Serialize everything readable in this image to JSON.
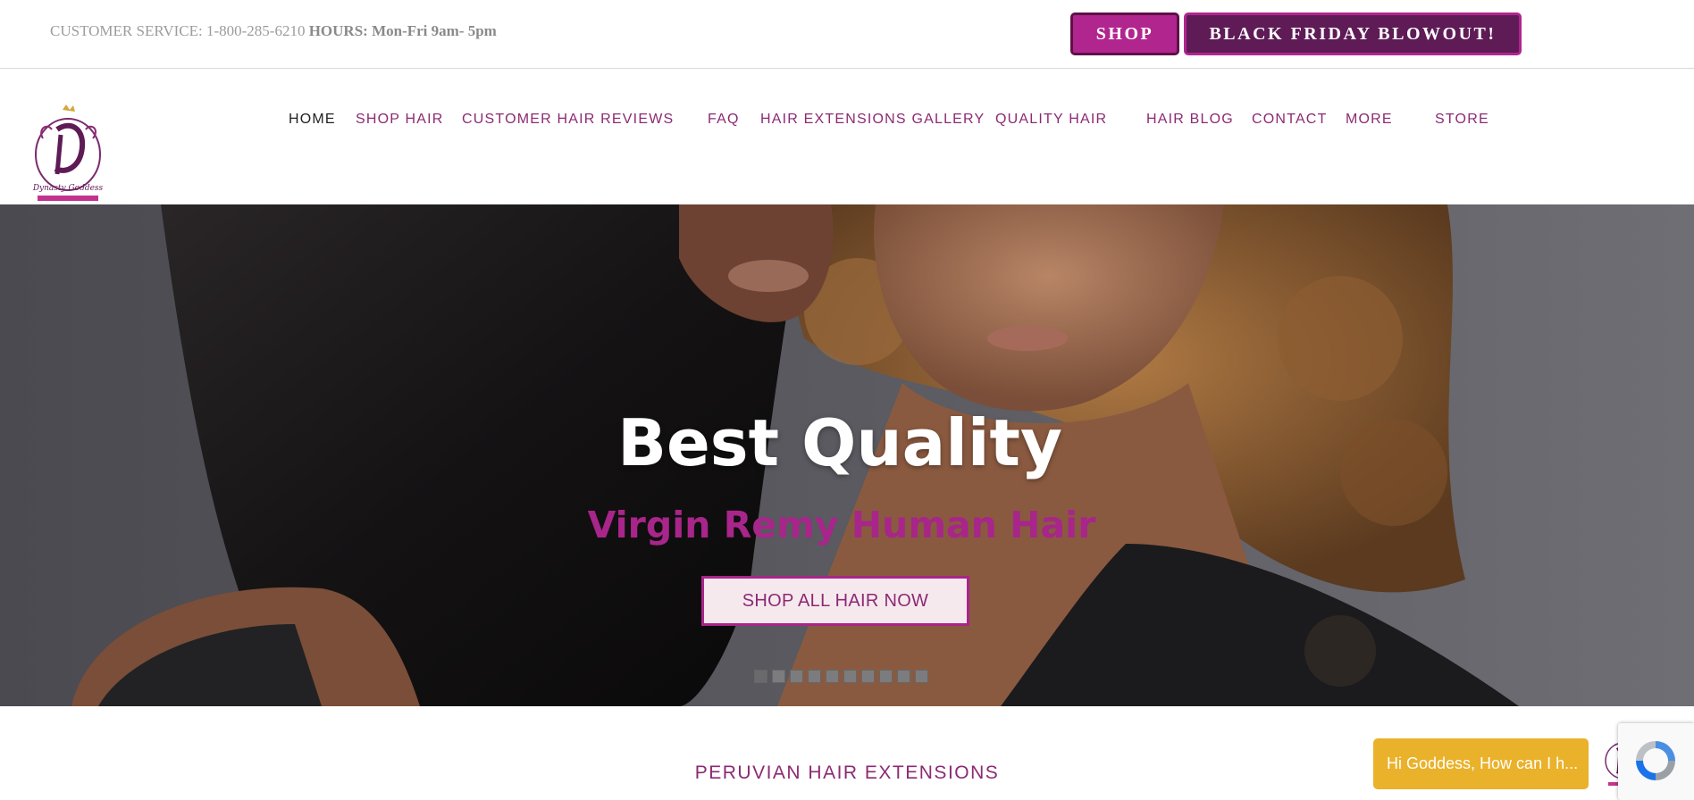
{
  "topbar": {
    "customer_service": "CUSTOMER SERVICE: 1-800-285-6210",
    "hours_label": "HOURS:",
    "hours_value": "Mon-Fri 9am- 5pm",
    "shop_button": "SHOP",
    "black_friday_button": "BLACK FRIDAY BLOWOUT!"
  },
  "nav": {
    "items": [
      {
        "label": "HOME",
        "active": true
      },
      {
        "label": "SHOP HAIR"
      },
      {
        "label": "CUSTOMER HAIR REVIEWS"
      },
      {
        "label": "FAQ"
      },
      {
        "label": "HAIR EXTENSIONS GALLERY"
      },
      {
        "label": "QUALITY HAIR"
      },
      {
        "label": "HAIR BLOG"
      },
      {
        "label": "CONTACT"
      },
      {
        "label": "MORE"
      },
      {
        "label": "STORE"
      }
    ]
  },
  "hero": {
    "title": "Best Quality",
    "subtitle": "Virgin Remy Human Hair",
    "cta": "SHOP ALL HAIR NOW",
    "slide_count": 10,
    "active_slide": 1
  },
  "section": {
    "title": "PERUVIAN HAIR EXTENSIONS"
  },
  "chat": {
    "message": "Hi Goddess, How can I h..."
  },
  "colors": {
    "brand_magenta": "#b1258e",
    "brand_plum": "#5e1b56",
    "nav_text": "#8c2a73",
    "chat_yellow": "#eab12a"
  },
  "icons": [
    "logo-icon",
    "chat-avatar-icon",
    "recaptcha-icon"
  ]
}
